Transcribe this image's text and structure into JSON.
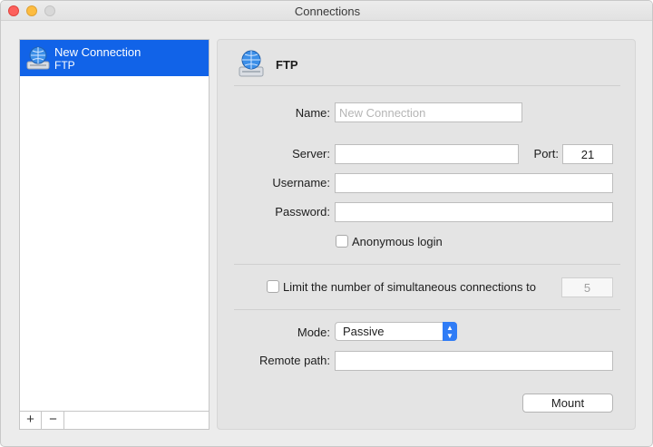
{
  "window": {
    "title": "Connections"
  },
  "sidebar": {
    "items": [
      {
        "name": "New Connection",
        "type": "FTP",
        "icon": "network-drive-icon",
        "selected": true
      }
    ],
    "footer": {
      "add_label": "+",
      "remove_label": "−"
    }
  },
  "panel": {
    "protocol": "FTP",
    "protocol_icon": "network-drive-icon",
    "name": {
      "label": "Name:",
      "value": "",
      "placeholder": "New Connection"
    },
    "server": {
      "label": "Server:",
      "value": ""
    },
    "port": {
      "label": "Port:",
      "value": "21"
    },
    "username": {
      "label": "Username:",
      "value": ""
    },
    "password": {
      "label": "Password:",
      "value": ""
    },
    "anonymous": {
      "label": "Anonymous login",
      "checked": false
    },
    "limit": {
      "label": "Limit the number of simultaneous connections to",
      "checked": false,
      "value": "5"
    },
    "mode": {
      "label": "Mode:",
      "value": "Passive"
    },
    "remote_path": {
      "label": "Remote path:",
      "value": ""
    },
    "mount_label": "Mount"
  },
  "colors": {
    "selection": "#1163e8",
    "accent": "#2f7cf6"
  }
}
